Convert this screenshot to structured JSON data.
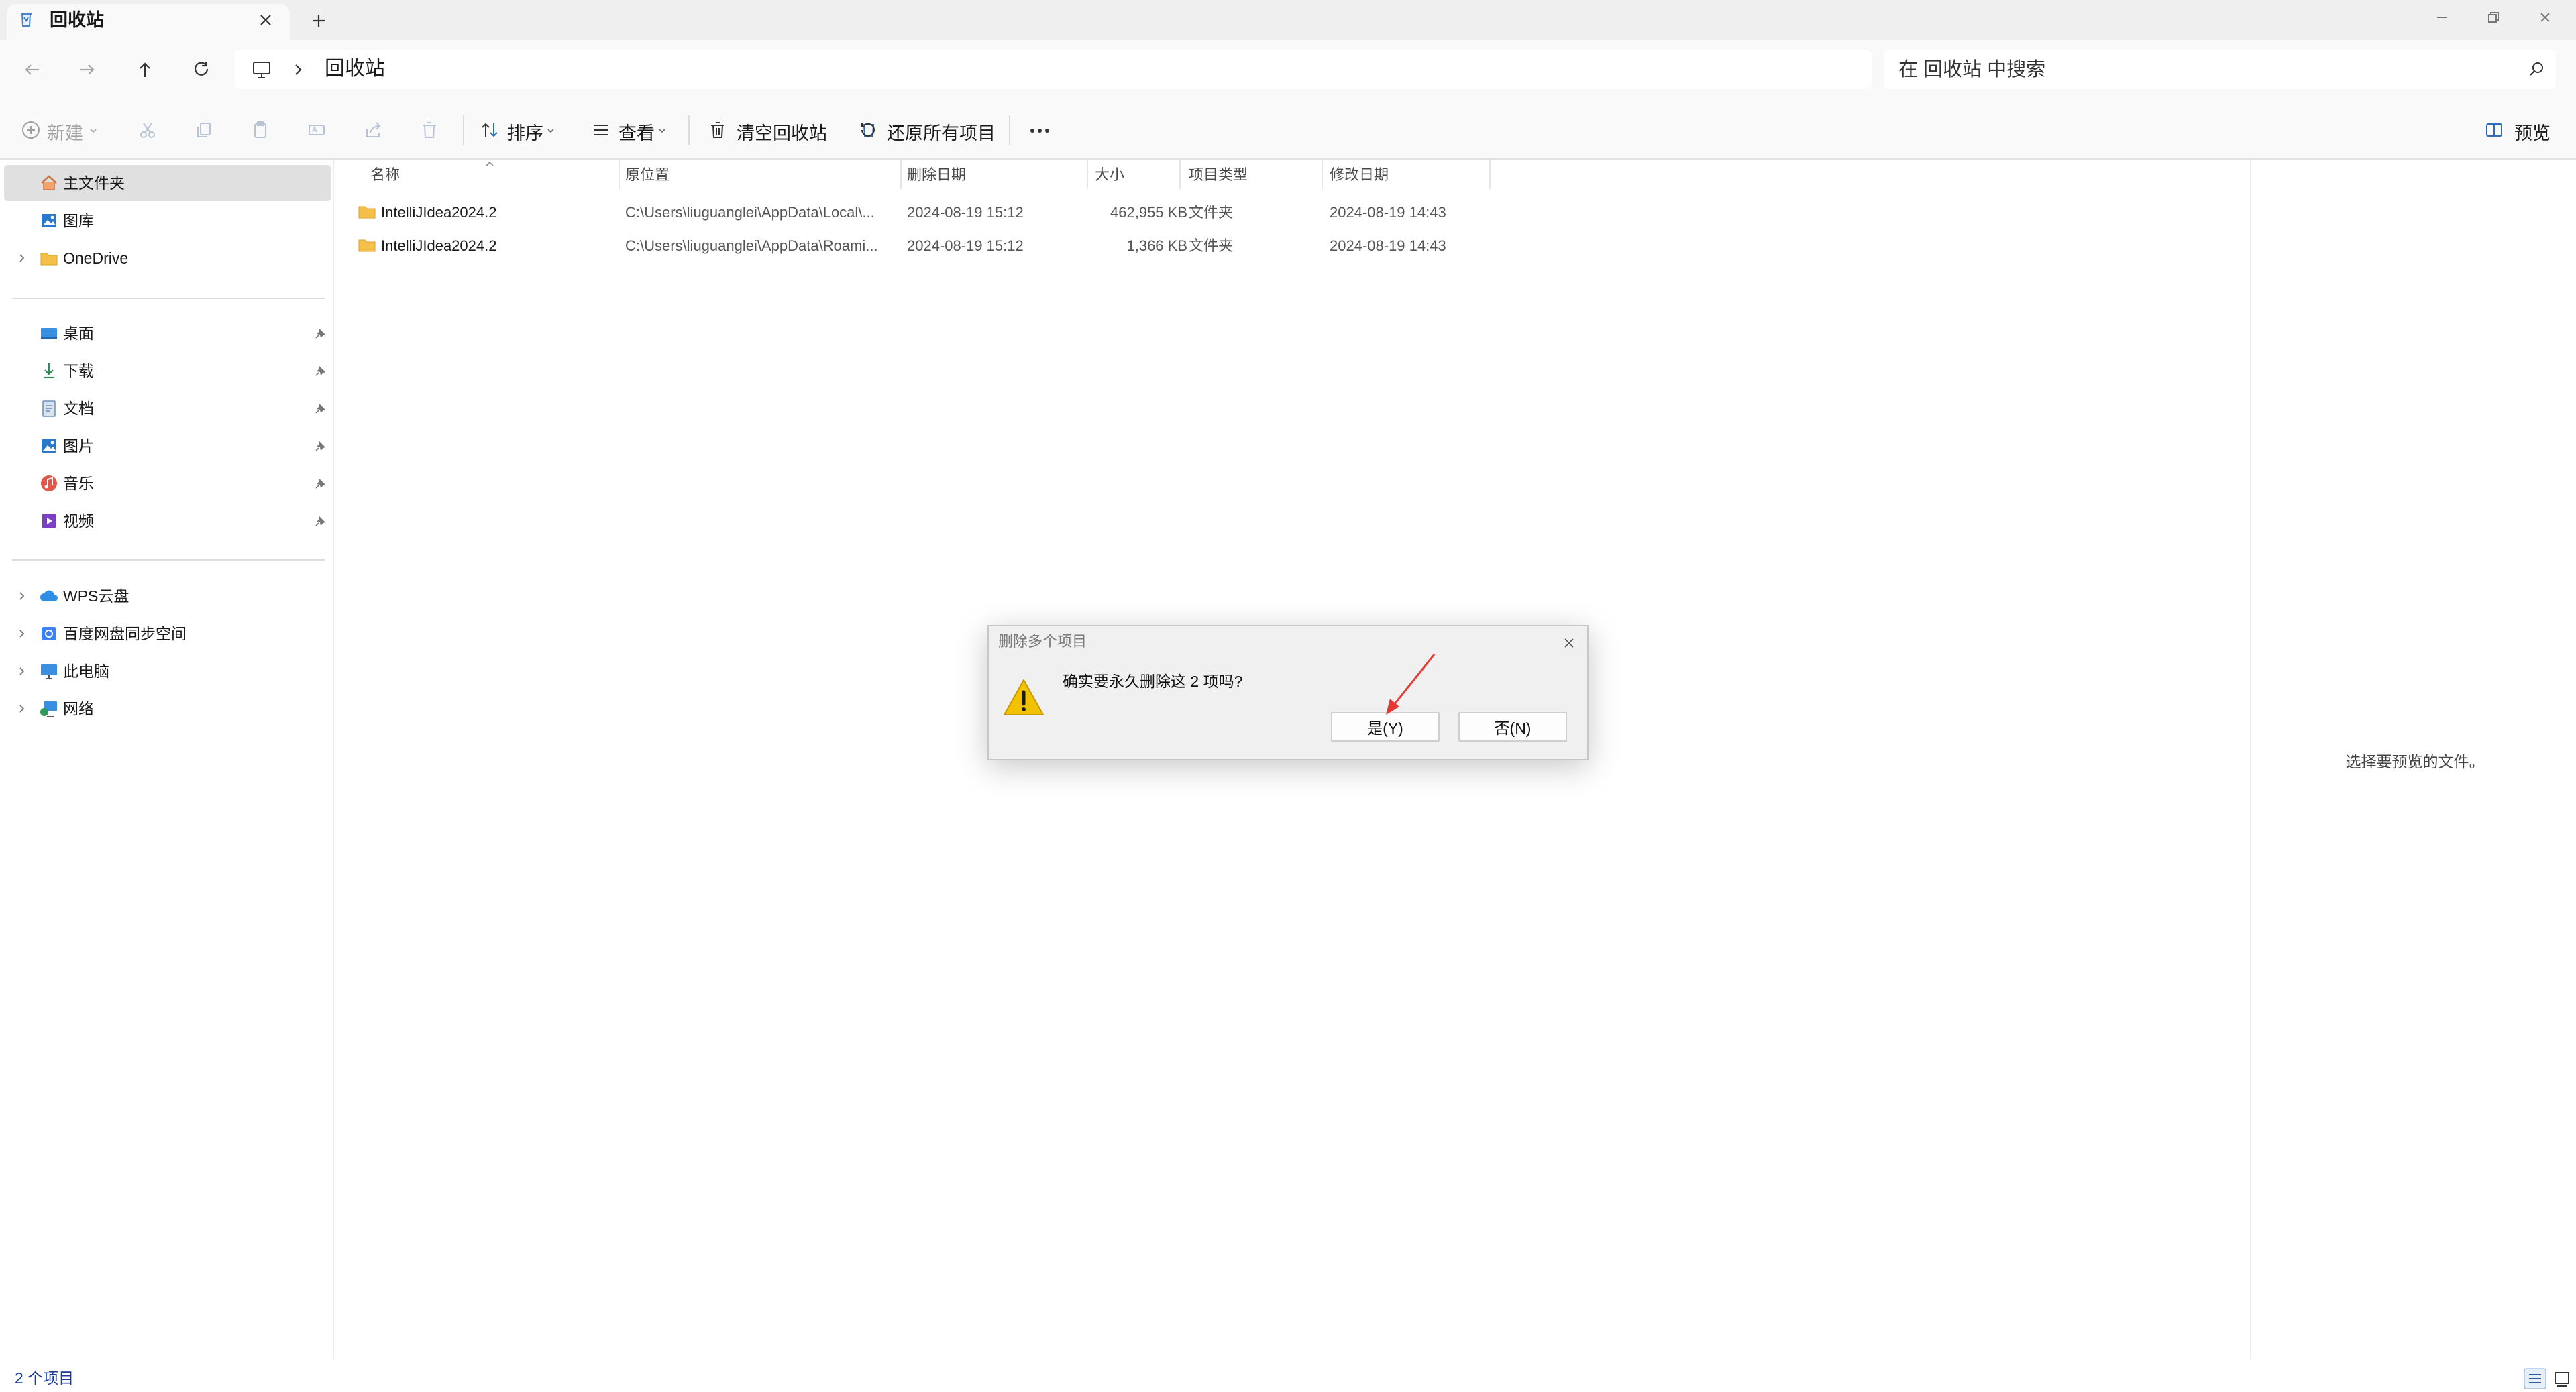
{
  "window": {
    "tab_title": "回收站",
    "tab_icon": "recycle-bin-icon",
    "controls": [
      "minimize-icon",
      "restore-icon",
      "close-icon"
    ]
  },
  "address": {
    "path": [
      "回收站"
    ],
    "search_placeholder": "在 回收站 中搜索"
  },
  "toolbar": {
    "new_label": "新建",
    "sort_label": "排序",
    "view_label": "查看",
    "empty_bin_label": "清空回收站",
    "restore_all_label": "还原所有项目",
    "preview_label": "预览",
    "disabled_icons": [
      "cut-icon",
      "copy-icon",
      "paste-icon",
      "rename-icon",
      "share-icon",
      "delete-icon"
    ]
  },
  "sidebar": {
    "top": [
      {
        "label": "主文件夹",
        "icon": "home-icon",
        "selected": true
      },
      {
        "label": "图库",
        "icon": "gallery-icon"
      },
      {
        "label": "OneDrive",
        "icon": "folder-icon",
        "expandable": true
      }
    ],
    "quick": [
      {
        "label": "桌面",
        "icon": "desktop-icon"
      },
      {
        "label": "下载",
        "icon": "download-icon"
      },
      {
        "label": "文档",
        "icon": "document-icon"
      },
      {
        "label": "图片",
        "icon": "pictures-icon"
      },
      {
        "label": "音乐",
        "icon": "music-icon"
      },
      {
        "label": "视频",
        "icon": "video-icon"
      }
    ],
    "bottom": [
      {
        "label": "WPS云盘",
        "icon": "cloud-icon"
      },
      {
        "label": "百度网盘同步空间",
        "icon": "baidu-sync-icon"
      },
      {
        "label": "此电脑",
        "icon": "computer-icon"
      },
      {
        "label": "网络",
        "icon": "network-icon"
      }
    ]
  },
  "file_list": {
    "columns": [
      "名称",
      "原位置",
      "删除日期",
      "大小",
      "项目类型",
      "修改日期"
    ],
    "rows": [
      {
        "name": "IntelliJIdea2024.2",
        "location": "C:\\Users\\liuguanglei\\AppData\\Local\\...",
        "deleted": "2024-08-19 15:12",
        "size": "462,955 KB",
        "type": "文件夹",
        "modified": "2024-08-19 14:43"
      },
      {
        "name": "IntelliJIdea2024.2",
        "location": "C:\\Users\\liuguanglei\\AppData\\Roami...",
        "deleted": "2024-08-19 15:12",
        "size": "1,366 KB",
        "type": "文件夹",
        "modified": "2024-08-19 14:43"
      }
    ]
  },
  "preview": {
    "empty_text": "选择要预览的文件。"
  },
  "status": {
    "item_count": "2 个项目"
  },
  "dialog": {
    "title": "删除多个项目",
    "message": "确实要永久删除这 2 项吗?",
    "yes_label": "是(Y)",
    "no_label": "否(N)",
    "icon": "warning-icon"
  },
  "colors": {
    "accent": "#0067c0",
    "folder": "#f5c04a",
    "warning": "#f2c200",
    "annotation_arrow": "#e53935"
  }
}
